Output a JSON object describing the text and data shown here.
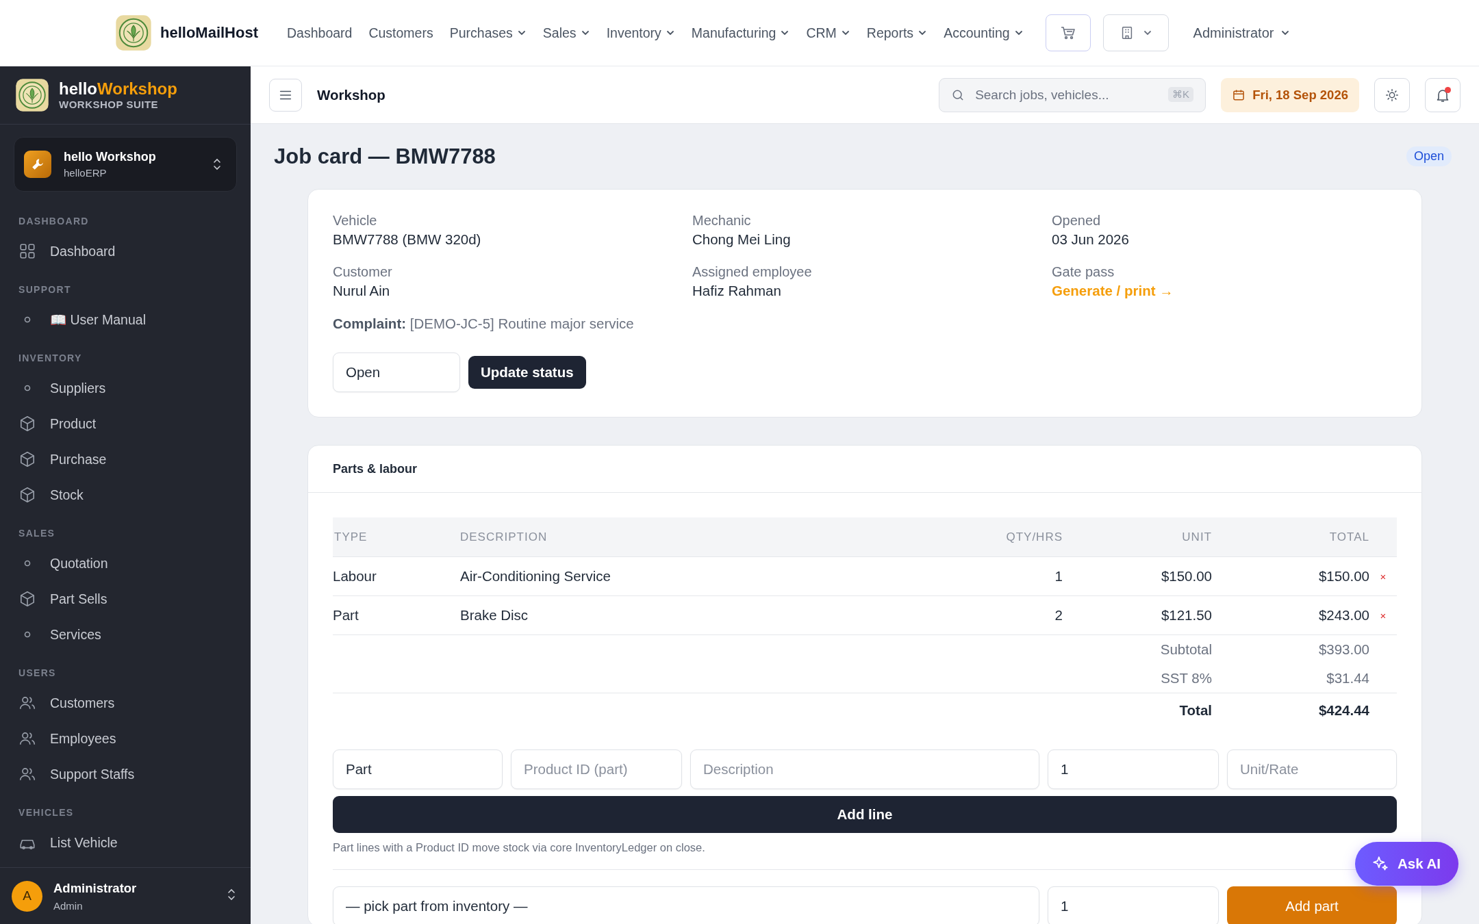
{
  "top_nav": {
    "brand": "helloMailHost",
    "items": [
      {
        "label": "Dashboard",
        "dropdown": false
      },
      {
        "label": "Customers",
        "dropdown": false
      },
      {
        "label": "Purchases",
        "dropdown": true
      },
      {
        "label": "Sales",
        "dropdown": true
      },
      {
        "label": "Inventory",
        "dropdown": true
      },
      {
        "label": "Manufacturing",
        "dropdown": true
      },
      {
        "label": "CRM",
        "dropdown": true
      },
      {
        "label": "Reports",
        "dropdown": true
      },
      {
        "label": "Accounting",
        "dropdown": true
      }
    ],
    "user": "Administrator"
  },
  "sidebar": {
    "brand_prefix": "hello",
    "brand_accent": "Workshop",
    "subtitle": "WORKSHOP SUITE",
    "workspace": {
      "name": "hello Workshop",
      "subtitle": "helloERP"
    },
    "sections": [
      {
        "heading": "DASHBOARD",
        "items": [
          {
            "label": "Dashboard",
            "kind": "grid"
          }
        ]
      },
      {
        "heading": "SUPPORT",
        "items": [
          {
            "label": "📖 User Manual",
            "kind": "dot"
          }
        ]
      },
      {
        "heading": "INVENTORY",
        "items": [
          {
            "label": "Suppliers",
            "kind": "dot"
          },
          {
            "label": "Product",
            "kind": "box"
          },
          {
            "label": "Purchase",
            "kind": "box"
          },
          {
            "label": "Stock",
            "kind": "box"
          }
        ]
      },
      {
        "heading": "SALES",
        "items": [
          {
            "label": "Quotation",
            "kind": "dot"
          },
          {
            "label": "Part Sells",
            "kind": "box"
          },
          {
            "label": "Services",
            "kind": "dot"
          }
        ]
      },
      {
        "heading": "USERS",
        "items": [
          {
            "label": "Customers",
            "kind": "users"
          },
          {
            "label": "Employees",
            "kind": "users"
          },
          {
            "label": "Support Staffs",
            "kind": "users"
          }
        ]
      },
      {
        "heading": "VEHICLES",
        "items": [
          {
            "label": "List Vehicle",
            "kind": "car"
          }
        ]
      }
    ],
    "footer": {
      "avatar": "A",
      "name": "Administrator",
      "role": "Admin"
    }
  },
  "header": {
    "title": "Workshop",
    "search_placeholder": "Search jobs, vehicles...",
    "shortcut": "⌘K",
    "date": "Fri, 18 Sep 2026"
  },
  "page": {
    "title": "Job card — BMW7788",
    "status": "Open"
  },
  "job_card": {
    "fields": [
      {
        "label": "Vehicle",
        "value": "BMW7788 (BMW 320d)",
        "kind": "text"
      },
      {
        "label": "Mechanic",
        "value": "Chong Mei Ling",
        "kind": "text"
      },
      {
        "label": "Opened",
        "value": "03 Jun 2026",
        "kind": "text"
      },
      {
        "label": "Customer",
        "value": "Nurul Ain",
        "kind": "text"
      },
      {
        "label": "Assigned employee",
        "value": "Hafiz Rahman",
        "kind": "text"
      },
      {
        "label": "Gate pass",
        "value": "Generate / print →",
        "kind": "link"
      }
    ],
    "complaint": "**Complaint:** [DEMO-JC-5] Routine major service",
    "status_value": "Open",
    "update_button": "Update status"
  },
  "parts": {
    "title": "Parts & labour",
    "columns": [
      "TYPE",
      "DESCRIPTION",
      "QTY/HRS",
      "UNIT",
      "TOTAL"
    ],
    "rows": [
      {
        "type": "Labour",
        "description": "Air-Conditioning Service",
        "qty": "1",
        "unit": "$150.00",
        "total": "$150.00",
        "remove": "×"
      },
      {
        "type": "Part",
        "description": "Brake Disc",
        "qty": "2",
        "unit": "$121.50",
        "total": "$243.00",
        "remove": "×"
      }
    ],
    "summary": [
      {
        "label": "Subtotal",
        "value": "$393.00",
        "kind": "sub"
      },
      {
        "label": "SST 8%",
        "value": "$31.44",
        "kind": "sub"
      },
      {
        "label": "Total",
        "value": "$424.44",
        "kind": "total"
      }
    ],
    "form": [
      {
        "kind": "select",
        "value": "Part"
      },
      {
        "kind": "input",
        "placeholder": "Product ID (part)"
      },
      {
        "kind": "input",
        "placeholder": "Description"
      },
      {
        "kind": "input",
        "value": "1"
      },
      {
        "kind": "input",
        "placeholder": "Unit/Rate"
      }
    ],
    "add_line": "Add line",
    "note": "Part lines with a Product ID move stock via core InventoryLedger on close.",
    "pick": {
      "select": "— pick part from inventory —",
      "qty": "1",
      "button": "Add part"
    }
  },
  "ask_ai": "Ask AI"
}
